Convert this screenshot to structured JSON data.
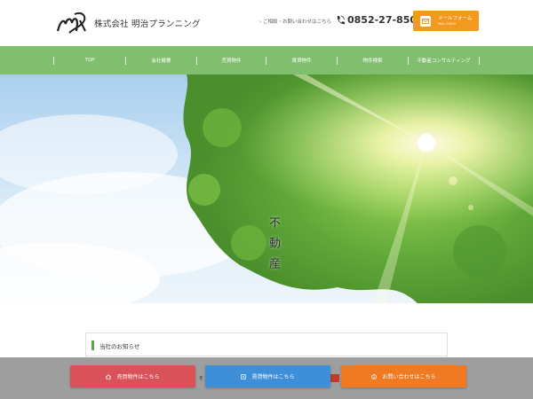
{
  "header": {
    "company_name": "株式会社 明治プランニング",
    "contact_link": "› ご相談・お問い合わせはこちら",
    "phone": "0852-27-8505",
    "mailform": {
      "label": "メールフォーム",
      "sub": "MAIL FORM"
    }
  },
  "nav": {
    "items": [
      {
        "label": "TOP"
      },
      {
        "label": "会社概要"
      },
      {
        "label": "売買物件"
      },
      {
        "label": "賃貸物件"
      },
      {
        "label": "物件検索"
      },
      {
        "label": "不動産コンサルティング"
      }
    ]
  },
  "hero": {
    "vertical_text": "不動産",
    "colors": {
      "sky": "#cfe6f5",
      "leaf": "#6fb83a",
      "sun": "#fff6c8"
    }
  },
  "news": {
    "title": "当社のお知らせ"
  },
  "underlay": {
    "text": "を"
  },
  "cta": {
    "sale": "売買物件はこちら",
    "rent": "賃貸物件はこちら",
    "contact": "お問い合わせはこちら"
  },
  "colors": {
    "nav_green": "#7fbf6e",
    "mailform_orange": "#f39a1e",
    "cta_red": "#d9525a",
    "cta_blue": "#3f8fd8",
    "cta_orange": "#ef7a23"
  }
}
